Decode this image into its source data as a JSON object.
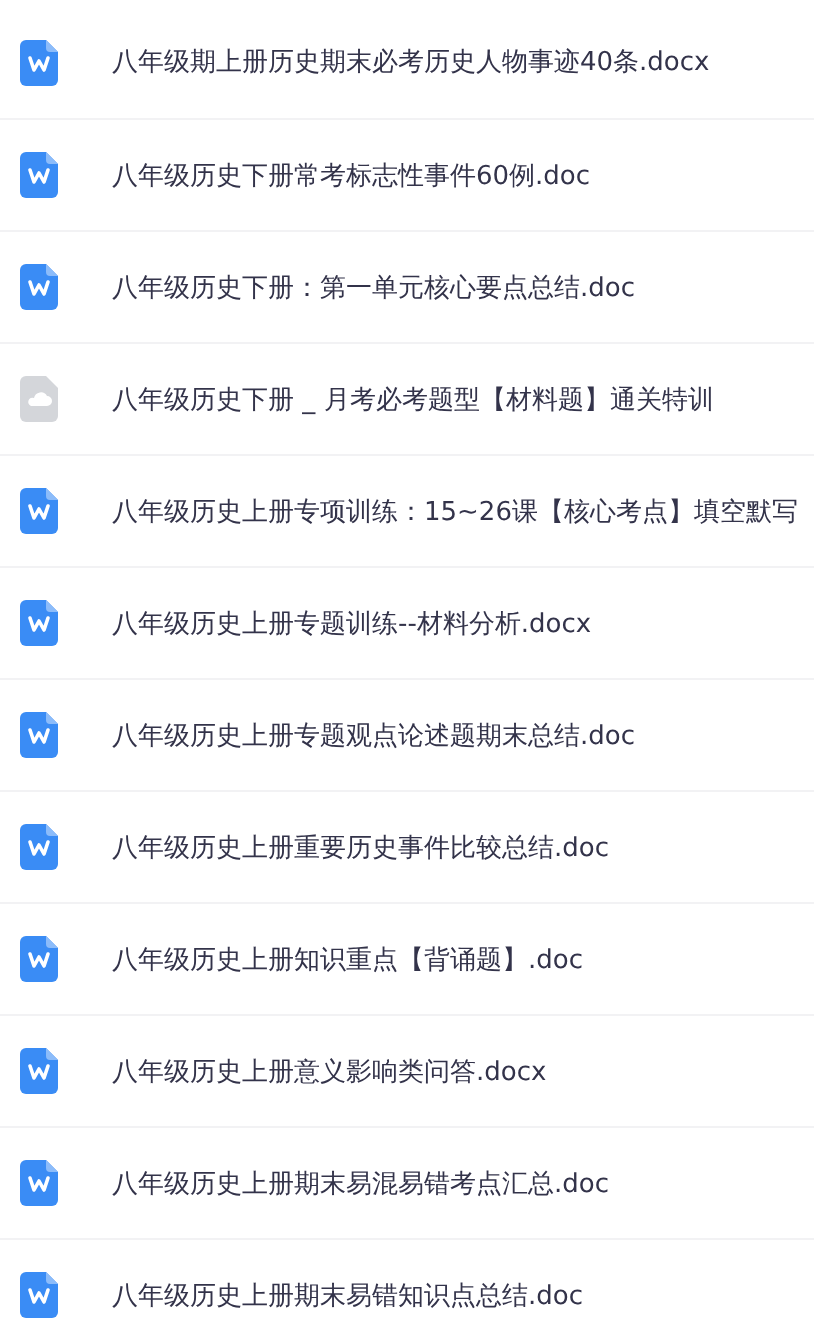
{
  "files": [
    {
      "name": "八年级期上册历史期末必考历史人物事迹40条.docx",
      "kind": "word"
    },
    {
      "name": "八年级历史下册常考标志性事件60例.doc",
      "kind": "word"
    },
    {
      "name": "八年级历史下册：第一单元核心要点总结.doc",
      "kind": "word"
    },
    {
      "name": "八年级历史下册 _ 月考必考题型【材料题】通关特训",
      "kind": "cloud"
    },
    {
      "name": "八年级历史上册专项训练：15~26课【核心考点】填空默写",
      "kind": "word"
    },
    {
      "name": "八年级历史上册专题训练--材料分析.docx",
      "kind": "word"
    },
    {
      "name": "八年级历史上册专题观点论述题期末总结.doc",
      "kind": "word"
    },
    {
      "name": "八年级历史上册重要历史事件比较总结.doc",
      "kind": "word"
    },
    {
      "name": "八年级历史上册知识重点【背诵题】.doc",
      "kind": "word"
    },
    {
      "name": "八年级历史上册意义影响类问答.docx",
      "kind": "word"
    },
    {
      "name": "八年级历史上册期末易混易错考点汇总.doc",
      "kind": "word"
    },
    {
      "name": "八年级历史上册期末易错知识点总结.doc",
      "kind": "word"
    }
  ]
}
